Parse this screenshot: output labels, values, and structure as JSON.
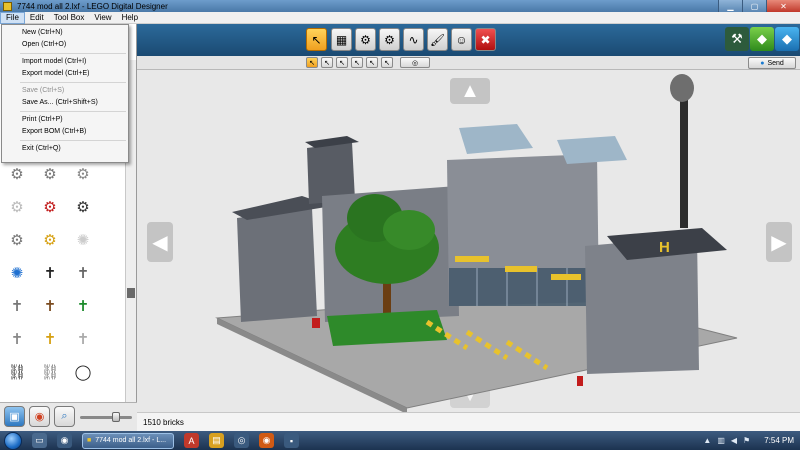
{
  "window": {
    "title": "7744 mod all 2.lxf - LEGO Digital Designer",
    "minimize_icon": "minimize-icon",
    "maximize_icon": "maximize-icon",
    "close_icon": "close-icon"
  },
  "menubar": {
    "items": [
      "File",
      "Edit",
      "Tool Box",
      "View",
      "Help"
    ]
  },
  "file_menu": {
    "items": [
      {
        "label": "New   (Ctrl+N)",
        "enabled": true
      },
      {
        "label": "Open   (Ctrl+O)",
        "enabled": true
      },
      {
        "label": "Import model   (Ctrl+I)",
        "enabled": true
      },
      {
        "label": "Export model   (Ctrl+E)",
        "enabled": true
      },
      {
        "label": "Save   (Ctrl+S)",
        "enabled": false
      },
      {
        "label": "Save As...   (Ctrl+Shift+S)",
        "enabled": true
      },
      {
        "label": "Print   (Ctrl+P)",
        "enabled": true
      },
      {
        "label": "Export BOM   (Ctrl+B)",
        "enabled": true
      },
      {
        "label": "Exit   (Ctrl+Q)",
        "enabled": true
      }
    ]
  },
  "toolbar": {
    "tools": [
      "select-tool-icon",
      "clone-tool-icon",
      "hinge-tool-icon",
      "hinge-align-tool-icon",
      "flex-tool-icon",
      "paint-tool-icon",
      "hide-tool-icon",
      "delete-tool-icon"
    ],
    "modes": [
      "build-mode-icon",
      "view-mode-icon",
      "building-guide-mode-icon"
    ]
  },
  "subtoolbar": {
    "send_label": "Send"
  },
  "status": {
    "brick_count": "1510 bricks"
  },
  "taskbar": {
    "task_label": "7744 mod all 2.lxf - L...",
    "clock": "7:54 PM"
  },
  "colors": {
    "toolbar_blue": "#1a4a72",
    "select_highlight": "#f0a020",
    "canvas_bg": "#e8e8e8"
  }
}
